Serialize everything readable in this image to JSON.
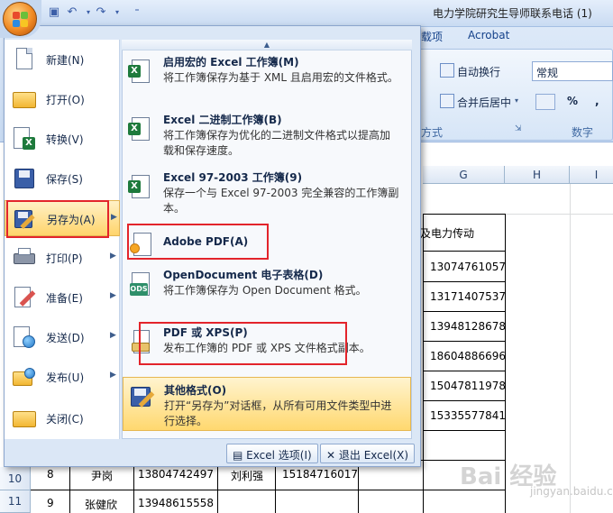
{
  "window": {
    "title": "电力学院研究生导师联系电话 (1)"
  },
  "ribbon": {
    "tabs": [
      "载项",
      "Acrobat"
    ],
    "wrap_text": "自动换行",
    "merge_center": "合并后居中",
    "number_format": "常规",
    "percent": "%",
    "comma": ",",
    "group_align": "方式",
    "group_number": "数字"
  },
  "sheet": {
    "columns": [
      "G",
      "H",
      "I"
    ],
    "header_fragment": "及电力传动",
    "phones_g": [
      "13074761057",
      "13171407537",
      "13948128678",
      "18604886696",
      "15047811978",
      "15335577841"
    ],
    "row_headers": [
      "10",
      "11"
    ],
    "rows": [
      {
        "no": "8",
        "name": "尹岗",
        "phone": "13804742497",
        "name2": "刘利强",
        "phone2": "15184716017"
      },
      {
        "no": "9",
        "name": "张健欣",
        "phone": "13948615558",
        "name2": "",
        "phone2": ""
      }
    ]
  },
  "menu": {
    "left_items": [
      {
        "label": "新建(N)",
        "icon": "new-document-icon",
        "has_arrow": false
      },
      {
        "label": "打开(O)",
        "icon": "open-folder-icon",
        "has_arrow": false
      },
      {
        "label": "转换(V)",
        "icon": "convert-icon",
        "has_arrow": false
      },
      {
        "label": "保存(S)",
        "icon": "save-disk-icon",
        "has_arrow": false
      },
      {
        "label": "另存为(A)",
        "icon": "save-as-icon",
        "has_arrow": true
      },
      {
        "label": "打印(P)",
        "icon": "printer-icon",
        "has_arrow": true
      },
      {
        "label": "准备(E)",
        "icon": "prepare-icon",
        "has_arrow": true
      },
      {
        "label": "发送(D)",
        "icon": "send-icon",
        "has_arrow": true
      },
      {
        "label": "发布(U)",
        "icon": "publish-icon",
        "has_arrow": true
      },
      {
        "label": "关闭(C)",
        "icon": "close-folder-icon",
        "has_arrow": false
      }
    ],
    "right_items": [
      {
        "title": "启用宏的 Excel 工作簿(M)",
        "desc": "将工作簿保存为基于 XML 且启用宏的文件格式。"
      },
      {
        "title": "Excel 二进制工作簿(B)",
        "desc": "将工作簿保存为优化的二进制文件格式以提高加载和保存速度。"
      },
      {
        "title": "Excel 97-2003 工作簿(9)",
        "desc": "保存一个与 Excel 97-2003 完全兼容的工作簿副本。"
      },
      {
        "title": "Adobe PDF(A)",
        "desc": ""
      },
      {
        "title": "OpenDocument 电子表格(D)",
        "desc": "将工作簿保存为 Open Document 格式。"
      },
      {
        "title": "PDF 或 XPS(P)",
        "desc": "发布工作簿的 PDF 或 XPS 文件格式副本。"
      },
      {
        "title": "其他格式(O)",
        "desc": "打开“另存为”对话框，从所有可用文件类型中进行选择。"
      }
    ],
    "excel_options": "Excel 选项(I)",
    "exit_excel": "退出 Excel(X)"
  },
  "watermark": {
    "brand": "Bai 经验",
    "site": "jingyan.baidu.com"
  },
  "colors": {
    "highlight": "#ffd46b",
    "annotation_red": "#e3242b",
    "menu_bg": "#dbe7f6"
  }
}
